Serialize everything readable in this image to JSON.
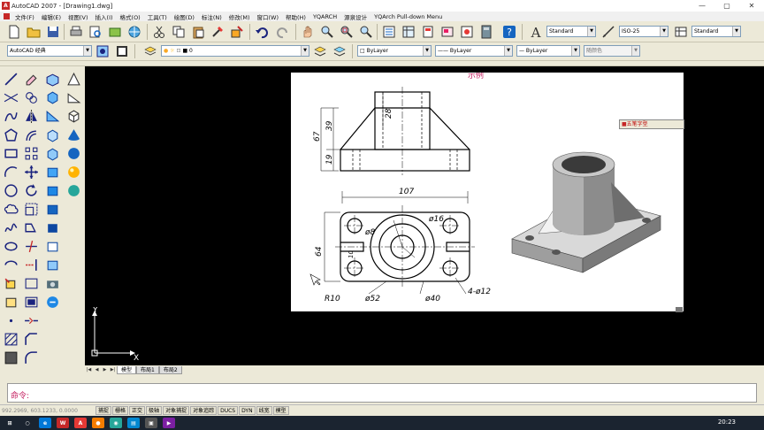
{
  "window": {
    "title": "AutoCAD 2007 - [Drawing1.dwg]",
    "app_icon": "A"
  },
  "menus": [
    "文件(F)",
    "编辑(E)",
    "视图(V)",
    "插入(I)",
    "格式(O)",
    "工具(T)",
    "绘图(D)",
    "标注(N)",
    "修改(M)",
    "窗口(W)",
    "帮助(H)",
    "YQARCH",
    "源泉设计",
    "YQArch Pull-down Menu"
  ],
  "toolbar": {
    "text_style": "Standard",
    "dim_style": "ISO-25",
    "table_style": "Standard",
    "workspace": "AutoCAD 经典",
    "layer": "0",
    "color": "ByLayer",
    "linetype": "ByLayer",
    "lineweight": "ByLayer",
    "plotstyle": "随颜色"
  },
  "floating_toolbar": {
    "label": "五笔字型"
  },
  "drawing": {
    "header_partial": "示例",
    "dims": {
      "d28": "28",
      "d39": "39",
      "d67": "67",
      "d19": "19",
      "d107": "107",
      "d64": "64",
      "phi16": "ø16",
      "phi8": "ø8",
      "d10": "10",
      "r10": "R10",
      "phi52": "ø52",
      "phi40": "ø40",
      "holes": "4-ø12"
    }
  },
  "ucs": {
    "x": "X",
    "y": "Y"
  },
  "tabs": [
    "模型",
    "布局1",
    "布局2"
  ],
  "command": {
    "prompt": "命令:"
  },
  "status": {
    "coords": "992.2969, 603.1233, 0.0000",
    "buttons": [
      "捕捉",
      "栅格",
      "正交",
      "极轴",
      "对象捕捉",
      "对象追踪",
      "DUCS",
      "DYN",
      "线宽",
      "模型"
    ]
  },
  "taskbar": {
    "clock": "20:23"
  },
  "colors": {
    "toolbar_bg": "#ece9d8",
    "canvas_bg": "#000000",
    "taskbar_bg": "#1b2430",
    "prompt_color": "#c2185b"
  }
}
